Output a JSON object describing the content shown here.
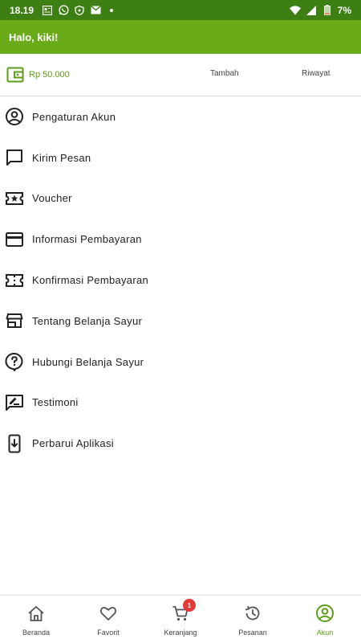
{
  "status_bar": {
    "time": "18.19",
    "battery_text": "7%",
    "icons_left": [
      "news-icon",
      "whatsapp-icon",
      "shield-icon",
      "gmail-icon",
      "dot-icon"
    ],
    "icons_right": [
      "wifi-icon",
      "signal-icon",
      "battery-icon"
    ]
  },
  "app_bar": {
    "greeting": "Halo, kiki!",
    "color": "#6aab1a"
  },
  "wallet": {
    "balance": "Rp 50.000",
    "add_label": "Tambah",
    "history_label": "Riwayat"
  },
  "menu": [
    {
      "label": "Pengaturan Akun",
      "icon": "account-circle-icon"
    },
    {
      "label": "Kirim Pesan",
      "icon": "message-icon"
    },
    {
      "label": "Voucher",
      "icon": "voucher-icon"
    },
    {
      "label": "Informasi Pembayaran",
      "icon": "credit-card-icon"
    },
    {
      "label": "Konfirmasi Pembayaran",
      "icon": "ticket-icon"
    },
    {
      "label": "Tentang Belanja Sayur",
      "icon": "store-icon"
    },
    {
      "label": "Hubungi Belanja Sayur",
      "icon": "help-bubble-icon"
    },
    {
      "label": "Testimoni",
      "icon": "rate-review-icon"
    },
    {
      "label": "Perbarui Aplikasi",
      "icon": "system-update-icon"
    }
  ],
  "bottom_nav": [
    {
      "label": "Beranda",
      "icon": "home-icon"
    },
    {
      "label": "Favorit",
      "icon": "heart-icon"
    },
    {
      "label": "Keranjang",
      "icon": "cart-icon",
      "badge": "1"
    },
    {
      "label": "Pesanan",
      "icon": "history-icon"
    },
    {
      "label": "Akun",
      "icon": "account-circle-icon",
      "active": true
    }
  ],
  "colors": {
    "accent": "#5c9e17",
    "badge": "#e53935",
    "status_bar": "#3d7f12"
  }
}
